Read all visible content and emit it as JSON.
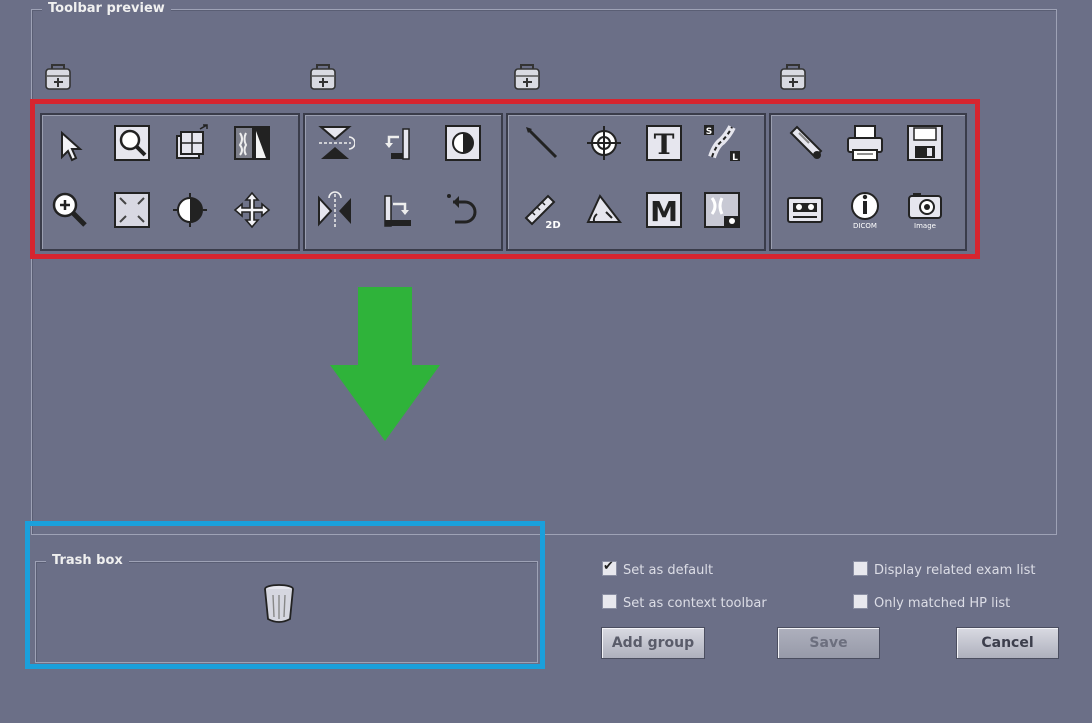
{
  "preview": {
    "legend": "Toolbar preview"
  },
  "trash": {
    "legend": "Trash box"
  },
  "toolbar_groups": [
    {
      "grip_icon": "drag-grip-icon",
      "tools": [
        "pointer-icon",
        "zoom-box-icon",
        "layout-grid-icon",
        "xray-invert-icon",
        "zoom-in-icon",
        "fit-screen-icon",
        "window-level-icon",
        "pan-icon"
      ]
    },
    {
      "grip_icon": "drag-grip-icon",
      "tools": [
        "flip-vertical-icon",
        "rotate-left-icon",
        "invert-half-icon",
        "flip-horizontal-icon",
        "rotate-right-icon",
        "undo-rotate-icon"
      ]
    },
    {
      "grip_icon": "drag-grip-icon",
      "tools": [
        "line-measure-icon",
        "crosshair-icon",
        "text-annotation-icon",
        "spine-label-icon",
        "ruler-2d-icon",
        "angle-icon",
        "magnify-m-icon",
        "xray-overlay-icon"
      ]
    },
    {
      "grip_icon": "drag-grip-icon",
      "tools": [
        "microphone-icon",
        "print-icon",
        "save-disk-icon",
        "tape-icon",
        "dicom-info-icon",
        "image-capture-icon"
      ]
    }
  ],
  "labels": {
    "dicom": "DICOM",
    "image": "Image",
    "m": "M",
    "t": "T",
    "s": "S",
    "l": "L",
    "d2": "2D"
  },
  "options": {
    "set_default": "Set as default",
    "set_context": "Set as context toolbar",
    "related_exam": "Display related exam list",
    "matched_hp": "Only matched HP list"
  },
  "buttons": {
    "add_group": "Add group",
    "save": "Save",
    "cancel": "Cancel"
  },
  "colors": {
    "highlight_red": "#d6252f",
    "highlight_blue": "#1aa0db",
    "arrow_green": "#2fb33a",
    "background": "#6b6f87"
  }
}
